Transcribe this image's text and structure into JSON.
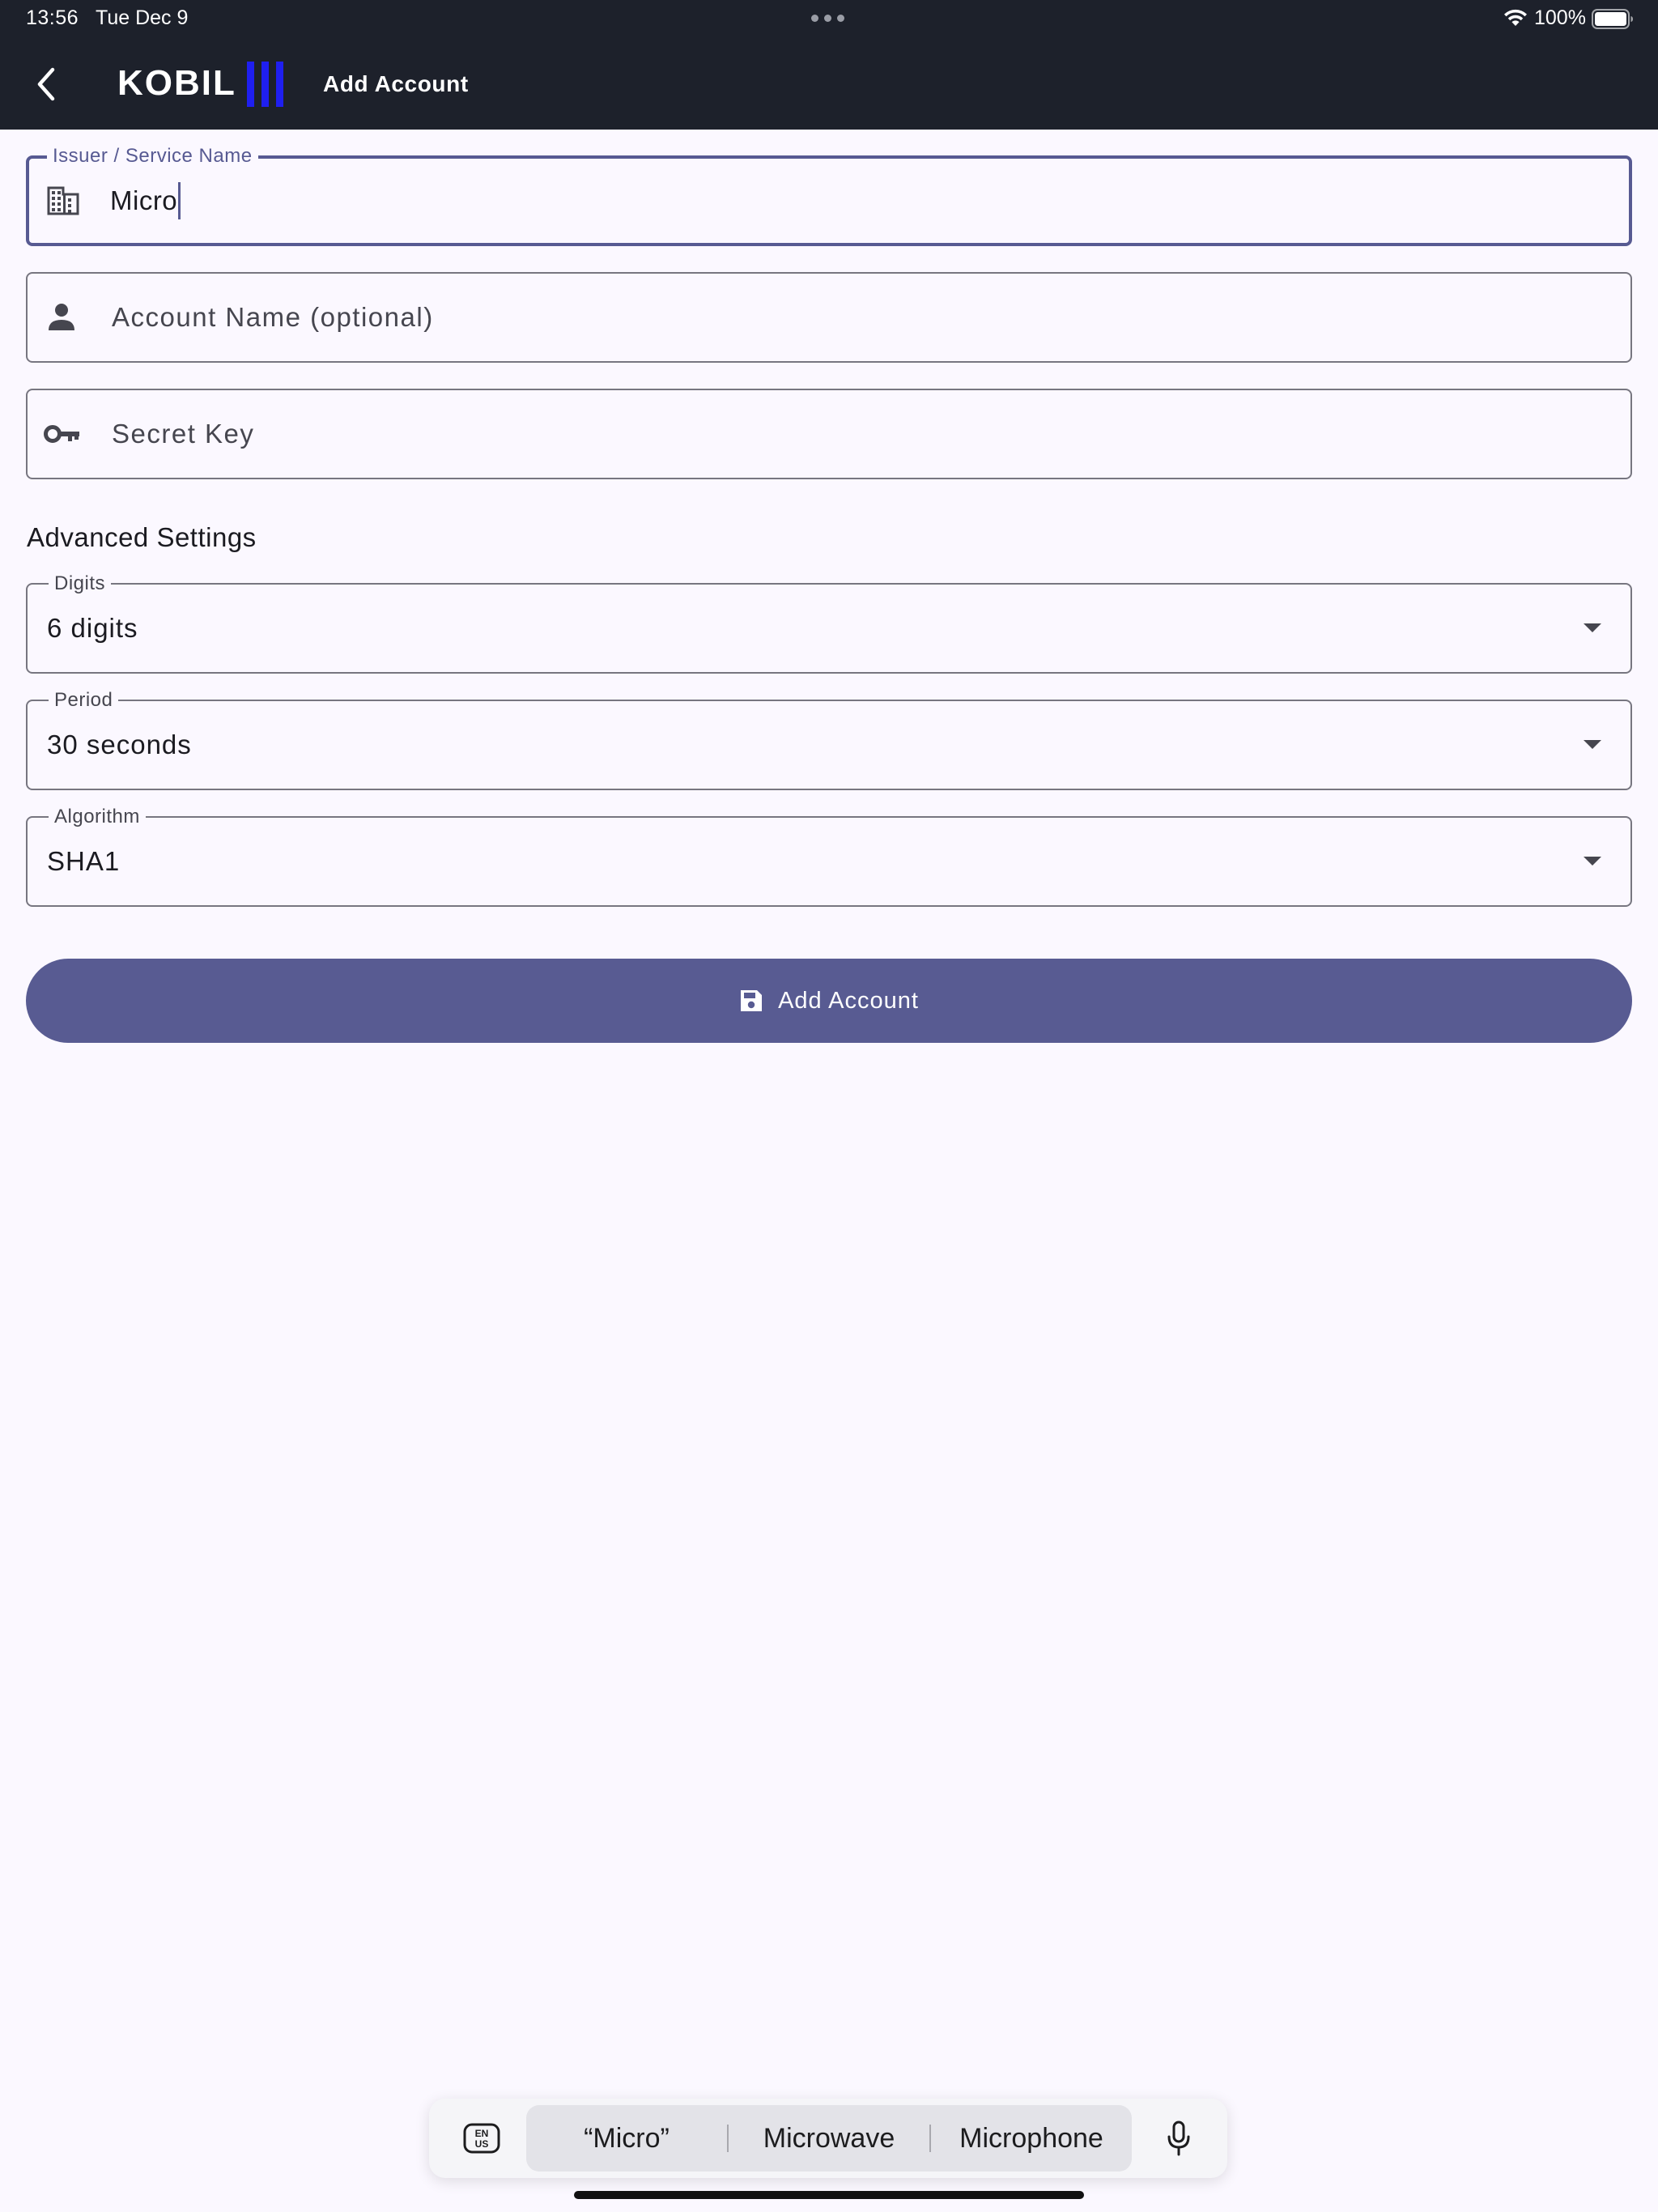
{
  "status_bar": {
    "time": "13:56",
    "date": "Tue Dec 9",
    "battery": "100%"
  },
  "app_bar": {
    "brand": "KOBIL",
    "title": "Add Account",
    "brand_bar_color": "#1f1ff0",
    "background_color": "#1d212b"
  },
  "form": {
    "issuer": {
      "label": "Issuer / Service Name",
      "value": "Micro",
      "icon": "building-icon",
      "focused": true
    },
    "account_name": {
      "placeholder": "Account Name (optional)",
      "icon": "person-icon"
    },
    "secret_key": {
      "placeholder": "Secret Key",
      "icon": "key-icon"
    }
  },
  "advanced": {
    "title": "Advanced Settings",
    "digits": {
      "label": "Digits",
      "value": "6 digits"
    },
    "period": {
      "label": "Period",
      "value": "30 seconds"
    },
    "algorithm": {
      "label": "Algorithm",
      "value": "SHA1"
    }
  },
  "submit": {
    "label": "Add Account",
    "icon": "save-icon",
    "color": "#585b92"
  },
  "keyboard_bar": {
    "suggestions": [
      "“Micro”",
      "Microwave",
      "Microphone"
    ],
    "language_icon": "EN US",
    "mic_icon": "microphone-icon"
  }
}
